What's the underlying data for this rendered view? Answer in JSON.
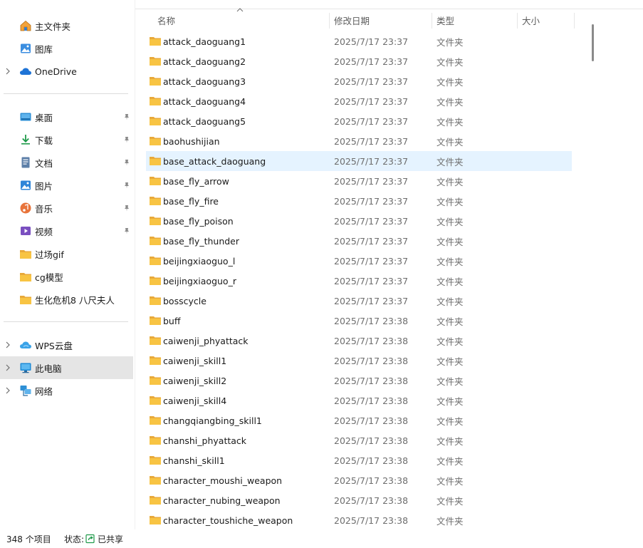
{
  "sidebar": {
    "items": [
      {
        "label": "主文件夹",
        "icon": "home-icon",
        "expandable": false
      },
      {
        "label": "图库",
        "icon": "gallery-icon",
        "expandable": false
      },
      {
        "label": "OneDrive",
        "icon": "cloud-icon",
        "expandable": true
      }
    ],
    "quick_access": [
      {
        "label": "桌面",
        "icon": "desktop-icon",
        "pinned": true
      },
      {
        "label": "下载",
        "icon": "download-icon",
        "pinned": true
      },
      {
        "label": "文档",
        "icon": "document-icon",
        "pinned": true
      },
      {
        "label": "图片",
        "icon": "picture-icon",
        "pinned": true
      },
      {
        "label": "音乐",
        "icon": "music-icon",
        "pinned": true
      },
      {
        "label": "视频",
        "icon": "video-icon",
        "pinned": true
      },
      {
        "label": "过场gif",
        "icon": "folder-icon",
        "pinned": false
      },
      {
        "label": "cg模型",
        "icon": "folder-icon",
        "pinned": false
      },
      {
        "label": "生化危机8 八尺夫人",
        "icon": "folder-icon",
        "pinned": false
      }
    ],
    "locations": [
      {
        "label": "WPS云盘",
        "icon": "wps-cloud-icon",
        "expandable": true
      },
      {
        "label": "此电脑",
        "icon": "computer-icon",
        "expandable": true,
        "selected": true
      },
      {
        "label": "网络",
        "icon": "network-icon",
        "expandable": true
      }
    ]
  },
  "columns": {
    "name": "名称",
    "date": "修改日期",
    "type": "类型",
    "size": "大小"
  },
  "files": [
    {
      "name": "attack_daoguang1",
      "date": "2025/7/17 23:37",
      "type": "文件夹"
    },
    {
      "name": "attack_daoguang2",
      "date": "2025/7/17 23:37",
      "type": "文件夹"
    },
    {
      "name": "attack_daoguang3",
      "date": "2025/7/17 23:37",
      "type": "文件夹"
    },
    {
      "name": "attack_daoguang4",
      "date": "2025/7/17 23:37",
      "type": "文件夹"
    },
    {
      "name": "attack_daoguang5",
      "date": "2025/7/17 23:37",
      "type": "文件夹"
    },
    {
      "name": "baohushijian",
      "date": "2025/7/17 23:37",
      "type": "文件夹"
    },
    {
      "name": "base_attack_daoguang",
      "date": "2025/7/17 23:37",
      "type": "文件夹",
      "hover": true
    },
    {
      "name": "base_fly_arrow",
      "date": "2025/7/17 23:37",
      "type": "文件夹"
    },
    {
      "name": "base_fly_fire",
      "date": "2025/7/17 23:37",
      "type": "文件夹"
    },
    {
      "name": "base_fly_poison",
      "date": "2025/7/17 23:37",
      "type": "文件夹"
    },
    {
      "name": "base_fly_thunder",
      "date": "2025/7/17 23:37",
      "type": "文件夹"
    },
    {
      "name": "beijingxiaoguo_l",
      "date": "2025/7/17 23:37",
      "type": "文件夹"
    },
    {
      "name": "beijingxiaoguo_r",
      "date": "2025/7/17 23:37",
      "type": "文件夹"
    },
    {
      "name": "bosscycle",
      "date": "2025/7/17 23:37",
      "type": "文件夹"
    },
    {
      "name": "buff",
      "date": "2025/7/17 23:38",
      "type": "文件夹"
    },
    {
      "name": "caiwenji_phyattack",
      "date": "2025/7/17 23:38",
      "type": "文件夹"
    },
    {
      "name": "caiwenji_skill1",
      "date": "2025/7/17 23:38",
      "type": "文件夹"
    },
    {
      "name": "caiwenji_skill2",
      "date": "2025/7/17 23:38",
      "type": "文件夹"
    },
    {
      "name": "caiwenji_skill4",
      "date": "2025/7/17 23:38",
      "type": "文件夹"
    },
    {
      "name": "changqiangbing_skill1",
      "date": "2025/7/17 23:38",
      "type": "文件夹"
    },
    {
      "name": "chanshi_phyattack",
      "date": "2025/7/17 23:38",
      "type": "文件夹"
    },
    {
      "name": "chanshi_skill1",
      "date": "2025/7/17 23:38",
      "type": "文件夹"
    },
    {
      "name": "character_moushi_weapon",
      "date": "2025/7/17 23:38",
      "type": "文件夹"
    },
    {
      "name": "character_nubing_weapon",
      "date": "2025/7/17 23:38",
      "type": "文件夹"
    },
    {
      "name": "character_toushiche_weapon",
      "date": "2025/7/17 23:38",
      "type": "文件夹"
    }
  ],
  "status": {
    "count": "348 个项目",
    "state_label": "状态:",
    "share": "已共享"
  },
  "colors": {
    "folder": "#F8C443",
    "folder_dark": "#E8A93A",
    "hover": "#E5F3FF",
    "selected": "#E5E5E5",
    "accent": "#0A64D2"
  }
}
